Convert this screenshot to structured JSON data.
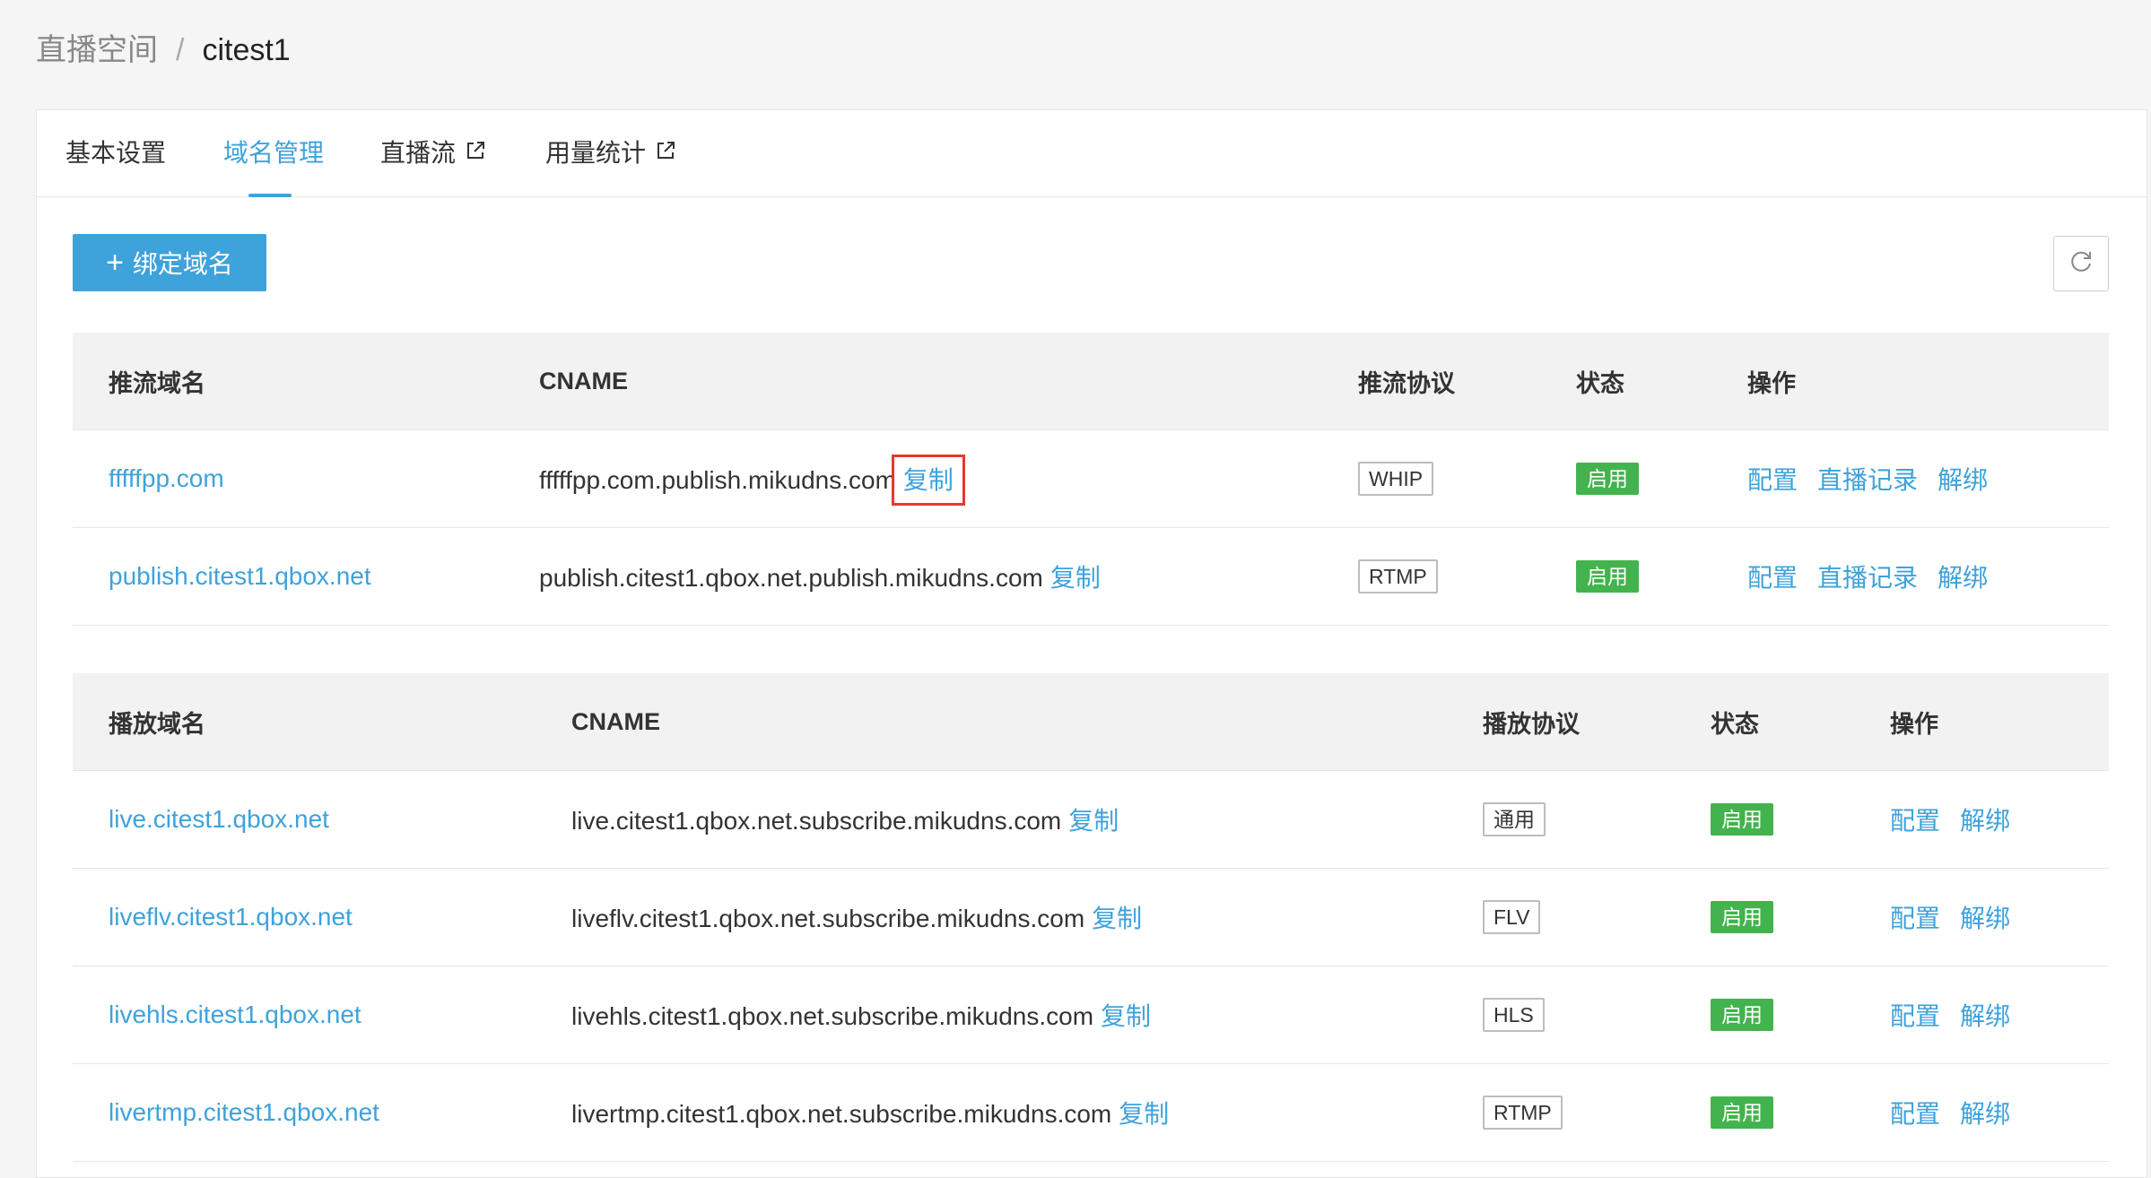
{
  "breadcrumb": {
    "parent": "直播空间",
    "separator": "/",
    "current": "citest1"
  },
  "tabs": [
    {
      "label": "基本设置"
    },
    {
      "label": "域名管理"
    },
    {
      "label": "直播流"
    },
    {
      "label": "用量统计"
    }
  ],
  "toolbar": {
    "bind_label": "绑定域名",
    "plus": "+"
  },
  "push_table": {
    "headers": [
      "推流域名",
      "CNAME",
      "推流协议",
      "状态",
      "操作"
    ],
    "rows": [
      {
        "domain": "fffffpp.com",
        "cname": "fffffpp.com.publish.mikudns.com",
        "copy": "复制",
        "protocol": "WHIP",
        "status": "启用",
        "ops": [
          "配置",
          "直播记录",
          "解绑"
        ]
      },
      {
        "domain": "publish.citest1.qbox.net",
        "cname": "publish.citest1.qbox.net.publish.mikudns.com",
        "copy": "复制",
        "protocol": "RTMP",
        "status": "启用",
        "ops": [
          "配置",
          "直播记录",
          "解绑"
        ]
      }
    ]
  },
  "play_table": {
    "headers": [
      "播放域名",
      "CNAME",
      "播放协议",
      "状态",
      "操作"
    ],
    "rows": [
      {
        "domain": "live.citest1.qbox.net",
        "cname": "live.citest1.qbox.net.subscribe.mikudns.com",
        "copy": "复制",
        "protocol": "通用",
        "status": "启用",
        "ops": [
          "配置",
          "解绑"
        ]
      },
      {
        "domain": "liveflv.citest1.qbox.net",
        "cname": "liveflv.citest1.qbox.net.subscribe.mikudns.com",
        "copy": "复制",
        "protocol": "FLV",
        "status": "启用",
        "ops": [
          "配置",
          "解绑"
        ]
      },
      {
        "domain": "livehls.citest1.qbox.net",
        "cname": "livehls.citest1.qbox.net.subscribe.mikudns.com",
        "copy": "复制",
        "protocol": "HLS",
        "status": "启用",
        "ops": [
          "配置",
          "解绑"
        ]
      },
      {
        "domain": "livertmp.citest1.qbox.net",
        "cname": "livertmp.citest1.qbox.net.subscribe.mikudns.com",
        "copy": "复制",
        "protocol": "RTMP",
        "status": "启用",
        "ops": [
          "配置",
          "解绑"
        ]
      }
    ]
  },
  "colors": {
    "accent": "#3ea2db",
    "status_green": "#43b34d",
    "highlight_red": "#e23a2e"
  },
  "icons": {
    "refresh": "refresh-icon",
    "external": "external-link-icon",
    "plus": "plus-icon"
  }
}
